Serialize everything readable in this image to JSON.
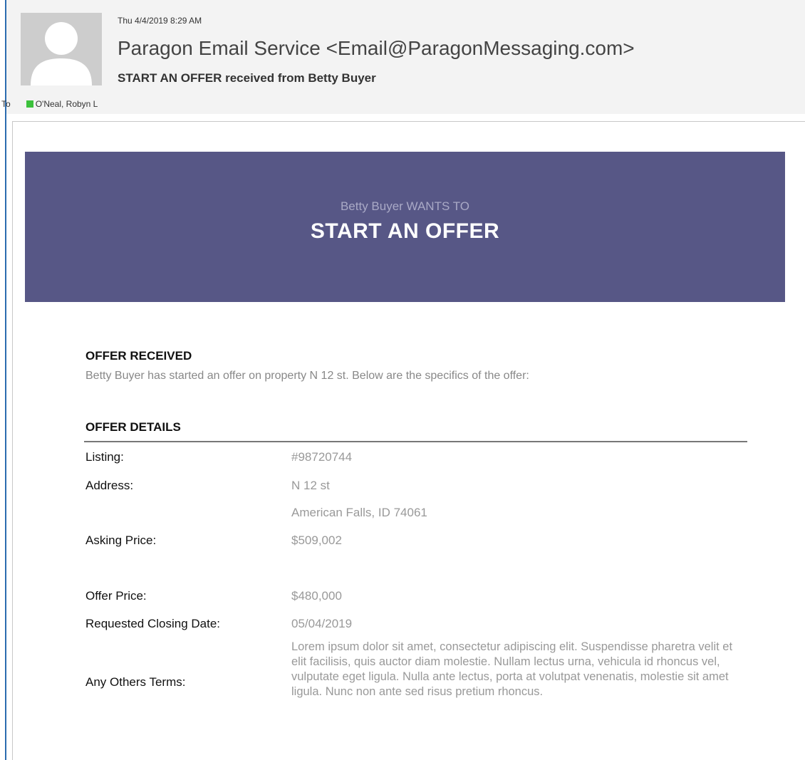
{
  "email": {
    "date": "Thu 4/4/2019 8:29 AM",
    "sender": "Paragon Email Service <Email@ParagonMessaging.com>",
    "subject": "START AN OFFER received from Betty Buyer",
    "to_label": "To",
    "recipient": "O'Neal, Robyn L",
    "presence_color": "#3cc13c",
    "avatar_icon": "default-contact-silhouette"
  },
  "banner": {
    "subtitle": "Betty Buyer WANTS TO",
    "title": "START AN OFFER",
    "background_color": "#575786"
  },
  "offer_received": {
    "heading": "OFFER RECEIVED",
    "text": "Betty Buyer has started an offer on property N 12 st. Below are the specifics of the offer:"
  },
  "offer_details": {
    "heading": "OFFER DETAILS",
    "listing_label": "Listing:",
    "listing_value": "#98720744",
    "address_label": "Address:",
    "address_line1": "N 12 st",
    "address_line2": "American Falls, ID 74061",
    "asking_label": "Asking Price:",
    "asking_value": "$509,002",
    "offer_label": "Offer Price:",
    "offer_value": "$480,000",
    "closing_label": "Requested Closing Date:",
    "closing_value": "05/04/2019",
    "terms_label": "Any Others Terms:",
    "terms_value": "Lorem ipsum dolor sit amet, consectetur adipiscing elit. Suspendisse pharetra velit et elit facilisis, quis auctor diam molestie. Nullam lectus urna, vehicula id rhoncus vel, vulputate eget ligula. Nulla ante lectus, porta at volutpat venenatis, molestie sit amet ligula. Nunc non ante sed risus pretium rhoncus."
  }
}
